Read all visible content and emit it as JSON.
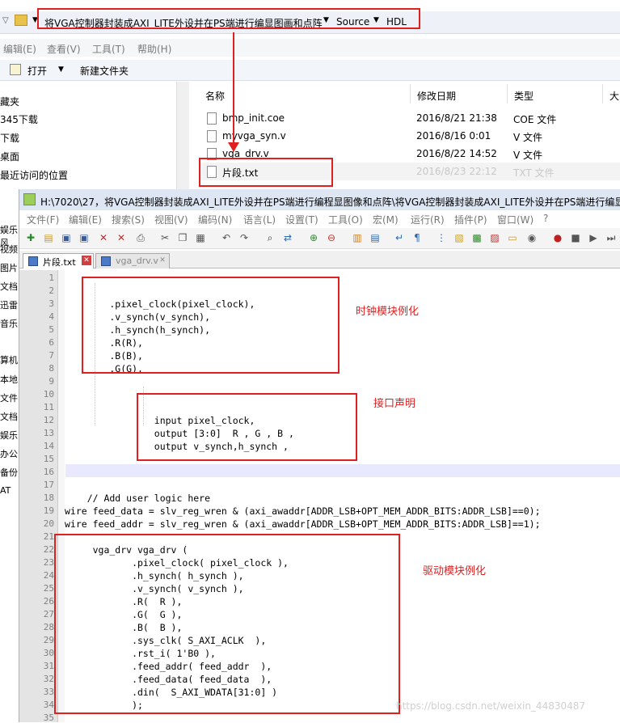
{
  "explorer": {
    "breadcrumb": [
      "将VGA控制器封装成AXI_LITE外设并在PS端进行编显图画和点阵",
      "Source",
      "HDL"
    ],
    "menu": [
      "编辑(E)",
      "查看(V)",
      "工具(T)",
      "帮助(H)"
    ],
    "toolbar": {
      "open_label": "打开",
      "new_folder_label": "新建文件夹"
    },
    "nav_items": [
      "藏夹",
      "345下载",
      "下载",
      "桌面",
      "最近访问的位置"
    ],
    "columns": [
      "名称",
      "修改日期",
      "类型",
      "大"
    ],
    "files": [
      {
        "name": "bmp_init.coe",
        "date": "2016/8/21 21:38",
        "type": "COE 文件"
      },
      {
        "name": "myvga_syn.v",
        "date": "2016/8/16 0:01",
        "type": "V 文件"
      },
      {
        "name": "vga_drv.v",
        "date": "2016/8/22 14:52",
        "type": "V 文件"
      },
      {
        "name": "片段.txt",
        "date": "2016/8/23 22:12",
        "type": "TXT 文件"
      }
    ],
    "left_labels": [
      "娱乐风",
      "视频",
      "图片",
      "文档",
      "迅雷",
      "音乐",
      "算机",
      "本地",
      "文件",
      "文档",
      "娱乐",
      "办公",
      "备份",
      "AT"
    ]
  },
  "editor": {
    "title": "H:\\7020\\27，将VGA控制器封装成AXI_LITE外设并在PS端进行编程显图像和点阵\\将VGA控制器封装成AXI_LITE外设并在PS端进行编显图",
    "menu": [
      "文件(F)",
      "编辑(E)",
      "搜索(S)",
      "视图(V)",
      "编码(N)",
      "语言(L)",
      "设置(T)",
      "工具(O)",
      "宏(M)",
      "运行(R)",
      "插件(P)",
      "窗口(W)",
      "?"
    ],
    "tabs": [
      "片段.txt",
      "vga_drv.v"
    ],
    "line_numbers": [
      "1",
      "2",
      "3",
      "4",
      "5",
      "6",
      "7",
      "8",
      "9",
      "10",
      "11",
      "12",
      "13",
      "14",
      "15",
      "16",
      "17",
      "18",
      "19",
      "20",
      "21",
      "22",
      "23",
      "24",
      "25",
      "26",
      "27",
      "28",
      "29",
      "30",
      "31",
      "32",
      "33",
      "34",
      "35"
    ],
    "lines": [
      "",
      "",
      "        .pixel_clock(pixel_clock),",
      "        .v_synch(v_synch),",
      "        .h_synch(h_synch),",
      "        .R(R),",
      "        .B(B),",
      "        .G(G),",
      "",
      "",
      "",
      "                input pixel_clock,",
      "                output [3:0]  R , G , B ,",
      "                output v_synch,h_synch ,",
      "",
      "",
      "",
      "    // Add user logic here",
      "wire feed_data = slv_reg_wren & (axi_awaddr[ADDR_LSB+OPT_MEM_ADDR_BITS:ADDR_LSB]==0);",
      "wire feed_addr = slv_reg_wren & (axi_awaddr[ADDR_LSB+OPT_MEM_ADDR_BITS:ADDR_LSB]==1);",
      "",
      "     vga_drv vga_drv (",
      "            .pixel_clock( pixel_clock ),",
      "            .h_synch( h_synch ),",
      "            .v_synch( v_synch ),",
      "            .R(  R ),",
      "            .G(  G ),",
      "            .B(  B ),",
      "            .sys_clk( S_AXI_ACLK  ),",
      "            .rst_i( 1'B0 ),",
      "            .feed_addr( feed_addr  ),",
      "            .feed_data( feed_data  ),",
      "            .din(  S_AXI_WDATA[31:0] )",
      "            );",
      ""
    ]
  },
  "annotations": {
    "clock": "时钟模块例化",
    "port": "接口声明",
    "driver": "驱动模块例化"
  },
  "watermark": "https://blog.csdn.net/weixin_44830487",
  "colors": {
    "highlight_box": "#e02020",
    "title_bar": "#dde6f2",
    "current_line": "#e8e8ff"
  }
}
